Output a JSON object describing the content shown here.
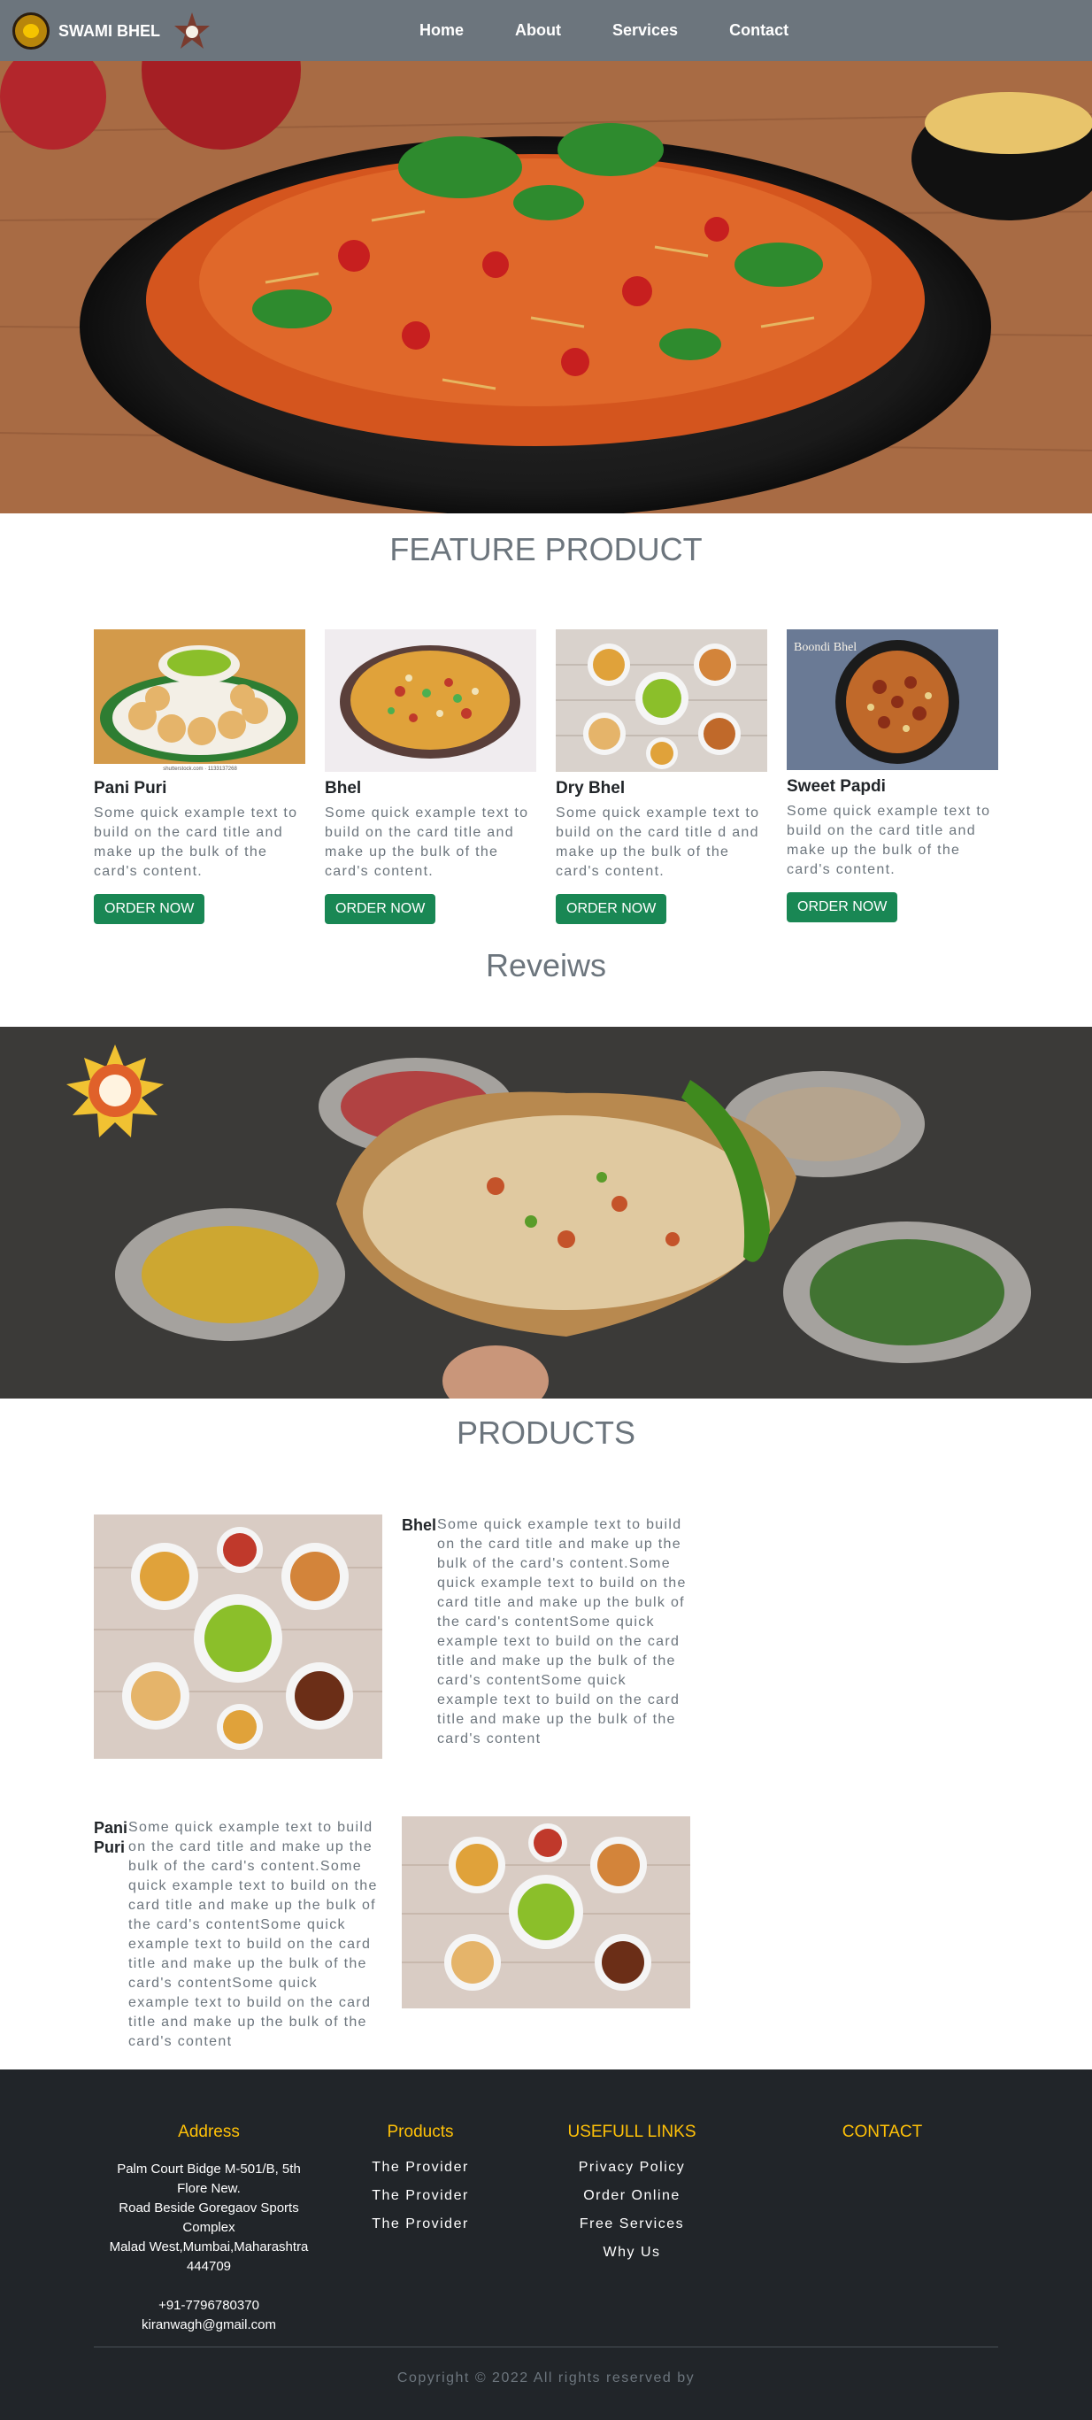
{
  "nav": {
    "brand": "SWAMI BHEL",
    "links": [
      "Home",
      "About",
      "Services",
      "Contact"
    ]
  },
  "feature": {
    "title": "FEATURE PRODUCT",
    "cards": [
      {
        "title": "Pani Puri",
        "text": "Some quick example text to build on the card title and make up the bulk of the card's content.",
        "button": "ORDER NOW",
        "img_caption": "shutterstock.com · 1133137268"
      },
      {
        "title": "Bhel",
        "text": "Some quick example text to build on the card title and make up the bulk of the card's content.",
        "button": "ORDER NOW"
      },
      {
        "title": "Dry Bhel",
        "text": "Some quick example text to build on the card title d and make up the bulk of the card's content.",
        "button": "ORDER NOW"
      },
      {
        "title": "Sweet Papdi",
        "text": "Some quick example text to build on the card title and make up the bulk of the card's content.",
        "button": "ORDER NOW",
        "img_caption": "Boondi Bhel"
      }
    ]
  },
  "reviews": {
    "title": "Reveiws"
  },
  "products": {
    "title": "PRODUCTS",
    "items": [
      {
        "name": "Bhel",
        "text": "Some quick example text to build on the card title and make up the bulk of the card's content.Some quick example text to build on the card title and make up the bulk of the card's contentSome quick example text to build on the card title and make up the bulk of the card's contentSome quick example text to build on the card title and make up the bulk of the card's content"
      },
      {
        "name": "Pani Puri",
        "text": "Some quick example text to build on the card title and make up the bulk of the card's content.Some quick example text to build on the card title and make up the bulk of the card's contentSome quick example text to build on the card title and make up the bulk of the card's contentSome quick example text to build on the card title and make up the bulk of the card's content"
      }
    ]
  },
  "footer": {
    "address": {
      "heading": "Address",
      "lines": [
        "Palm Court Bidge M-501/B, 5th",
        "Flore New.",
        "Road Beside Goregaov Sports",
        "Complex",
        "Malad West,Mumbai,Maharashtra",
        "444709"
      ],
      "phone": "+91-7796780370",
      "email": "kiranwagh@gmail.com"
    },
    "products": {
      "heading": "Products",
      "links": [
        "The Provider",
        "The Provider",
        "The Provider"
      ]
    },
    "useful": {
      "heading": "USEFULL LINKS",
      "links": [
        "Privacy Policy",
        "Order Online",
        "Free Services",
        "Why Us"
      ]
    },
    "contact": {
      "heading": "CONTACT"
    },
    "copyright": "Copyright © 2022 All rights reserved by"
  },
  "colors": {
    "nav_bg": "#6c757d",
    "button": "#198754",
    "footer_bg": "#212529",
    "footer_heading": "#ffc107",
    "muted": "#6c757d"
  }
}
